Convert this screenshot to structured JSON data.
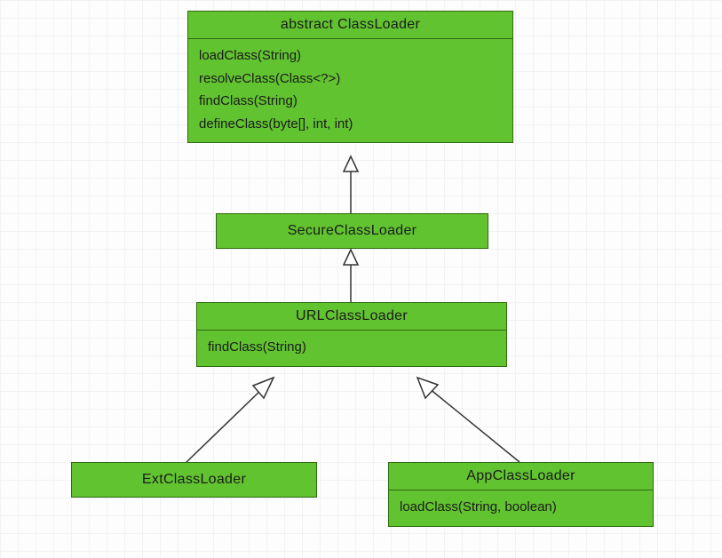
{
  "classes": {
    "abstract_classloader": {
      "title": "abstract ClassLoader",
      "methods": [
        "loadClass(String)",
        "resolveClass(Class<?>)",
        "findClass(String)",
        "defineClass(byte[], int, int)"
      ]
    },
    "secure_classloader": {
      "title": "SecureClassLoader"
    },
    "url_classloader": {
      "title": "URLClassLoader",
      "methods": [
        "findClass(String)"
      ]
    },
    "ext_classloader": {
      "title": "ExtClassLoader"
    },
    "app_classloader": {
      "title": "AppClassLoader",
      "methods": [
        "loadClass(String, boolean)"
      ]
    }
  },
  "relationships": [
    {
      "from": "secure_classloader",
      "to": "abstract_classloader",
      "type": "generalization"
    },
    {
      "from": "url_classloader",
      "to": "secure_classloader",
      "type": "generalization"
    },
    {
      "from": "ext_classloader",
      "to": "url_classloader",
      "type": "generalization"
    },
    {
      "from": "app_classloader",
      "to": "url_classloader",
      "type": "generalization"
    }
  ],
  "colors": {
    "box_fill": "#62c330",
    "box_border": "#2e6b0f",
    "connector": "#333333"
  }
}
